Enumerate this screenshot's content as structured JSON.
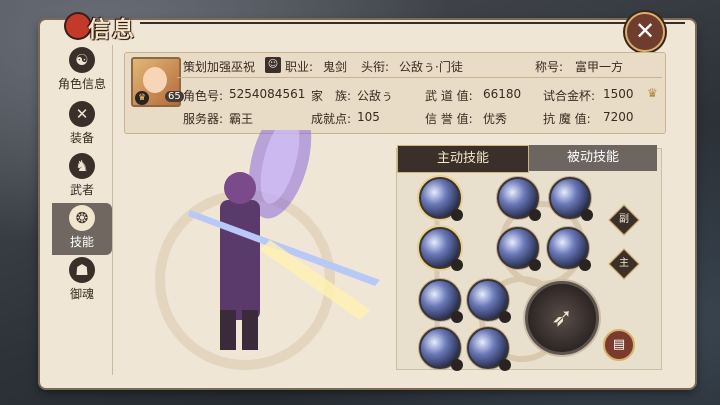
{
  "title": "信息",
  "close_label": "✕",
  "sidebar": {
    "items": [
      {
        "label": "角色信息",
        "icon": "profile-icon"
      },
      {
        "label": "装备",
        "icon": "swords-icon"
      },
      {
        "label": "武者",
        "icon": "warrior-icon"
      },
      {
        "label": "技能",
        "icon": "skill-icon",
        "active": true
      },
      {
        "label": "御魂",
        "icon": "soul-icon"
      }
    ]
  },
  "profile": {
    "name": "策划加强巫祝",
    "level": "65",
    "job_label": "职业:",
    "job_value": "鬼剑",
    "rank_label": "头衔:",
    "rank_value": "公敌ぅ·门徒",
    "honor_label": "称号:",
    "honor_value": "富甲一方",
    "role_id_label": "角色号:",
    "role_id_value": "5254084561",
    "family_label": "家　族:",
    "family_value": "公敌ぅ",
    "martial_label": "武 道 值:",
    "martial_value": "66180",
    "trial_label": "试合金杯:",
    "trial_value": "1500",
    "server_label": "服务器:",
    "server_value": "霸王",
    "achievement_label": "成就点:",
    "achievement_value": "105",
    "credit_label": "信 誉 值:",
    "credit_value": "优秀",
    "resist_label": "抗 魔 值:",
    "resist_value": "7200"
  },
  "skills": {
    "tab_active": "主动技能",
    "tab_inactive": "被动技能",
    "slot_markers": [
      "副",
      "主"
    ],
    "book_icon": "book-icon"
  },
  "colors": {
    "panel": "#efe6d6",
    "accent": "#3b2f2a",
    "gold": "#d8b06a",
    "close": "#6e3d2e"
  }
}
